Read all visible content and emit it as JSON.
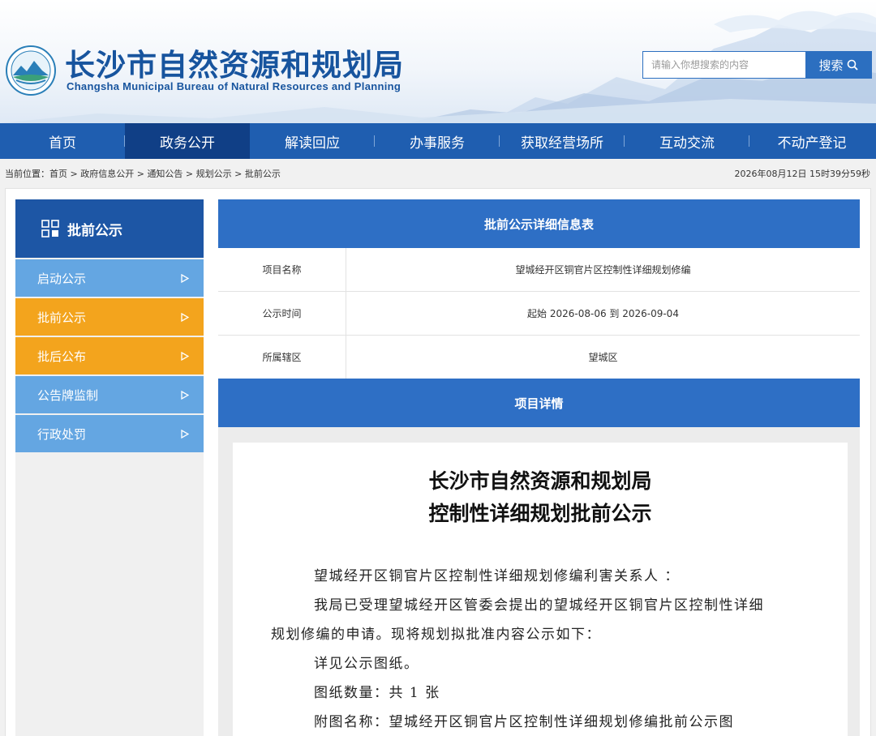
{
  "header": {
    "title": "长沙市自然资源和规划局",
    "subtitle": "Changsha Municipal Bureau of Natural Resources and Planning",
    "search": {
      "placeholder": "请输入你想搜索的内容",
      "button_label": "搜索"
    },
    "colors": {
      "brand": "#17549e",
      "nav": "#1f5eb0",
      "nav_active": "#103f86"
    }
  },
  "nav": {
    "items": [
      {
        "label": "首页"
      },
      {
        "label": "政务公开"
      },
      {
        "label": "解读回应"
      },
      {
        "label": "办事服务"
      },
      {
        "label": "获取经营场所"
      },
      {
        "label": "互动交流"
      },
      {
        "label": "不动产登记"
      }
    ],
    "active_index": 1
  },
  "breadcrumb": {
    "prefix": "当前位置：",
    "items": [
      "首页",
      "政府信息公开",
      "通知公告",
      "规划公示",
      "批前公示"
    ],
    "separator": " > "
  },
  "datetime": "2026年08月12日 15时39分59秒",
  "sidebar": {
    "title": "批前公示",
    "icon": "grid-icon",
    "items": [
      {
        "label": "启动公示",
        "state": "normal"
      },
      {
        "label": "批前公示",
        "state": "active"
      },
      {
        "label": "批后公布",
        "state": "active"
      },
      {
        "label": "公告牌监制",
        "state": "normal"
      },
      {
        "label": "行政处罚",
        "state": "normal"
      }
    ],
    "colors": {
      "head": "#1d56a5",
      "normal": "#64a6e2",
      "active": "#f3a41d"
    }
  },
  "detail_table": {
    "title": "批前公示详细信息表",
    "rows": [
      {
        "label": "项目名称",
        "value": "望城经开区铜官片区控制性详细规划修编"
      },
      {
        "label": "公示时间",
        "value": "起始 2026-08-06 到 2026-09-04"
      },
      {
        "label": "所属辖区",
        "value": "望城区"
      }
    ],
    "detail_heading": "项目详情"
  },
  "document": {
    "heading_line1": "长沙市自然资源和规划局",
    "heading_line2": "控制性详细规划批前公示",
    "paragraphs": [
      "望城经开区铜官片区控制性详细规划修编利害关系人 ：",
      "我局已受理望城经开区管委会提出的望城经开区铜官片区控制性详细",
      "规划修编的申请。现将规划拟批准内容公示如下：",
      "详见公示图纸。",
      "图纸数量：共 1 张",
      "附图名称：望城经开区铜官片区控制性详细规划修编批前公示图"
    ]
  }
}
